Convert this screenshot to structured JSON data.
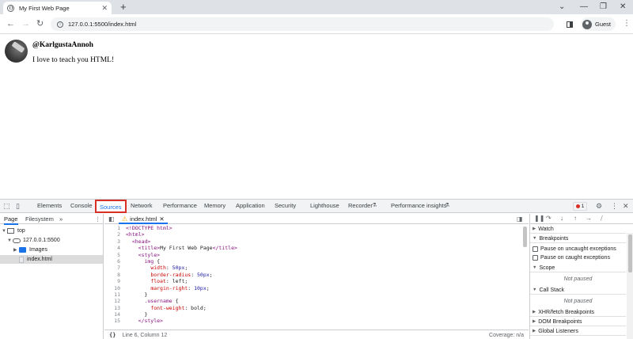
{
  "browser": {
    "tab_title": "My First Web Page",
    "url": "127.0.0.1:5500/index.html",
    "profile_label": "Guest"
  },
  "page": {
    "username": "@KarlgustaAnnoh",
    "intro": "I love to teach you HTML!"
  },
  "devtools": {
    "tabs": [
      "Elements",
      "Console",
      "Sources",
      "Network",
      "Performance",
      "Memory",
      "Application",
      "Security",
      "Lighthouse",
      "Recorder",
      "Performance insights"
    ],
    "active_tab": "Sources",
    "error_count": "1",
    "navigator": {
      "tab_page": "Page",
      "tab_filesystem": "Filesystem",
      "more": "»",
      "tree": [
        "top",
        "127.0.0.1:5500",
        "Images",
        "index.html"
      ]
    },
    "editor": {
      "file_tab": "index.html",
      "line_numbers": [
        "1",
        "2",
        "3",
        "4",
        "5",
        "6",
        "7",
        "8",
        "9",
        "10",
        "11",
        "12",
        "13",
        "14",
        "15"
      ],
      "status_braces": "{}",
      "status_position": "Line 6, Column 12",
      "coverage": "Coverage: n/a"
    },
    "debugger": {
      "watch": "Watch",
      "breakpoints": "Breakpoints",
      "pause_uncaught": "Pause on uncaught exceptions",
      "pause_caught": "Pause on caught exceptions",
      "scope": "Scope",
      "scope_status": "Not paused",
      "call_stack": "Call Stack",
      "call_stack_status": "Not paused",
      "xhr": "XHR/fetch Breakpoints",
      "dom": "DOM Breakpoints",
      "global": "Global Listeners"
    }
  }
}
